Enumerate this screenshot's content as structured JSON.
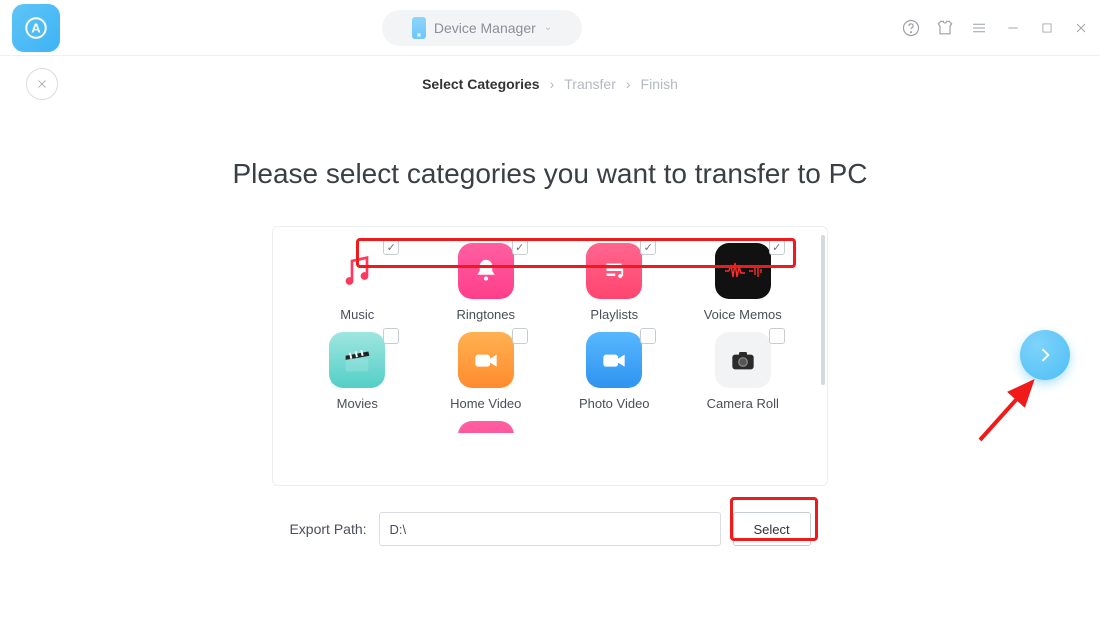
{
  "titlebar": {
    "device_label": "Device Manager"
  },
  "breadcrumb": {
    "step1": "Select Categories",
    "step2": "Transfer",
    "step3": "Finish"
  },
  "heading": "Please select categories you want to transfer to PC",
  "categories": {
    "row1": [
      {
        "name": "Music",
        "checked": true
      },
      {
        "name": "Ringtones",
        "checked": true
      },
      {
        "name": "Playlists",
        "checked": true
      },
      {
        "name": "Voice Memos",
        "checked": true
      }
    ],
    "row2": [
      {
        "name": "Movies",
        "checked": false
      },
      {
        "name": "Home Video",
        "checked": false
      },
      {
        "name": "Photo Video",
        "checked": false
      },
      {
        "name": "Camera Roll",
        "checked": false
      }
    ]
  },
  "export": {
    "label": "Export Path:",
    "value": "D:\\",
    "select_btn": "Select"
  }
}
